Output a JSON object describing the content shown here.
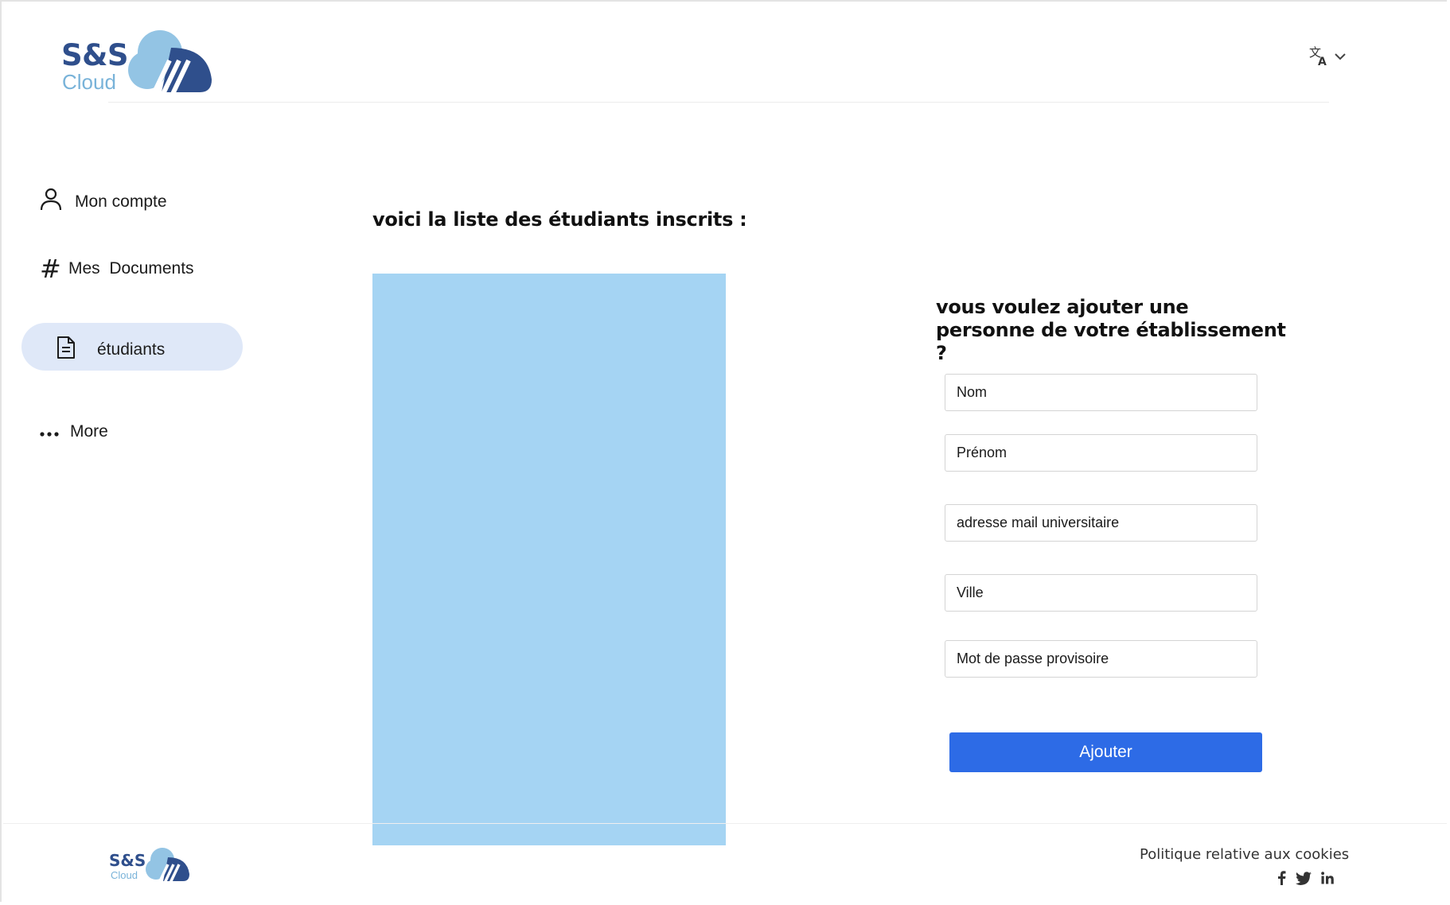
{
  "brand": {
    "logo_primary": "S&S",
    "logo_secondary": "Cloud",
    "colors": {
      "dark_blue": "#2f4f8c",
      "light_blue": "#79b3d9",
      "accent": "#2d6be6",
      "panel": "#a5d4f3",
      "active_nav_bg": "#dfe8f8"
    }
  },
  "header": {
    "language_icon": "translate-icon",
    "language_chevron": "chevron-down-icon"
  },
  "sidebar": {
    "items": [
      {
        "label": "Mon compte",
        "icon": "user-icon",
        "active": false
      },
      {
        "label": "Mes  Documents",
        "icon": "hash-icon",
        "active": false
      },
      {
        "label": "étudiants",
        "icon": "document-icon",
        "active": true
      },
      {
        "label": "More",
        "icon": "more-dots-icon",
        "active": false
      }
    ]
  },
  "main": {
    "list_title": "voici la liste des étudiants inscrits :"
  },
  "form": {
    "title": "vous voulez ajouter une personne de votre établissement ?",
    "fields": {
      "nom": "Nom",
      "prenom": "Prénom",
      "mail": "adresse mail universitaire",
      "ville": "Ville",
      "mdp": "Mot de passe provisoire"
    },
    "submit_label": "Ajouter"
  },
  "footer": {
    "logo_primary": "S&S",
    "logo_secondary": "Cloud",
    "cookies_link": "Politique relative aux cookies",
    "socials": [
      "facebook-icon",
      "twitter-icon",
      "linkedin-icon"
    ]
  }
}
